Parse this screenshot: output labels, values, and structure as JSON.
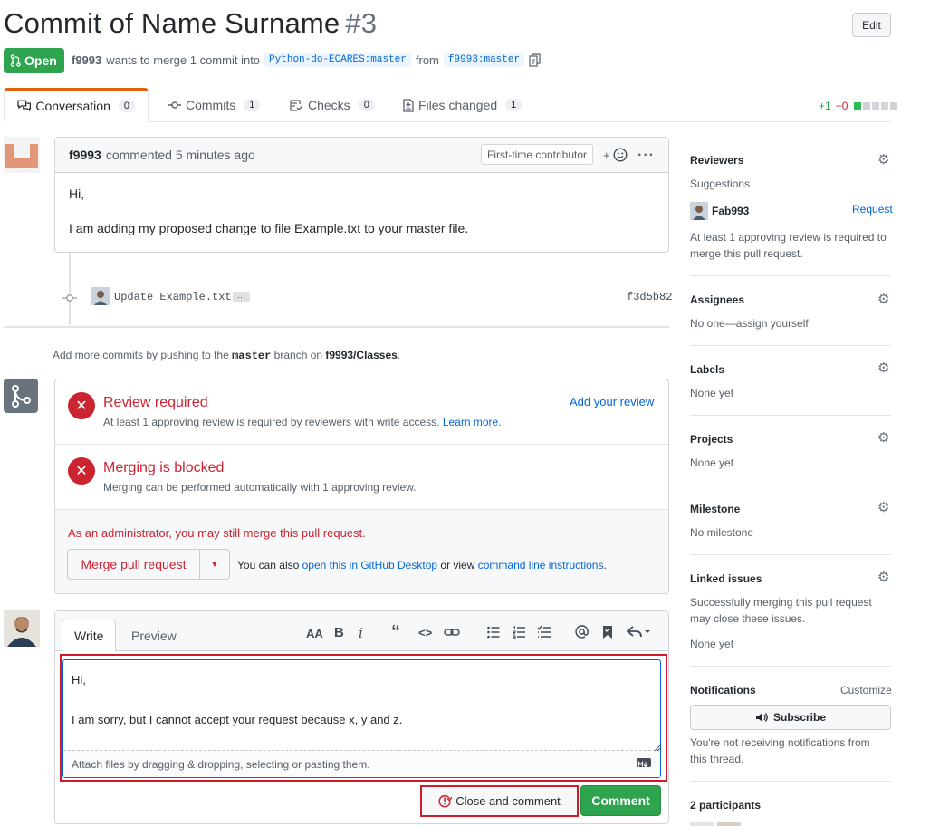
{
  "header": {
    "title": "Commit of Name Surname",
    "number": "#3",
    "edit_label": "Edit",
    "state": "Open",
    "author": "f9993",
    "merge_text": "wants to merge 1 commit into",
    "base_branch": "Python-do-ECARES:master",
    "from_text": "from",
    "head_branch": "f9993:master"
  },
  "tabs": [
    {
      "label": "Conversation",
      "count": "0"
    },
    {
      "label": "Commits",
      "count": "1"
    },
    {
      "label": "Checks",
      "count": "0"
    },
    {
      "label": "Files changed",
      "count": "1"
    }
  ],
  "diffstat": {
    "add": "+1",
    "del": "−0"
  },
  "comment": {
    "author": "f9993",
    "action": "commented 5 minutes ago",
    "badge": "First-time contributor",
    "line1": "Hi,",
    "line2": "I am adding my proposed change to file Example.txt to your master file."
  },
  "commit": {
    "message": "Update Example.txt",
    "ellipsis": "…",
    "sha": "f3d5b82"
  },
  "push_hint": {
    "pre": "Add more commits by pushing to the",
    "branch": "master",
    "mid": "branch on",
    "repo": "f9993/Classes",
    "post": "."
  },
  "merge_status": {
    "review_title": "Review required",
    "review_sub": "At least 1 approving review is required by reviewers with write access.",
    "learn_more": "Learn more.",
    "add_review": "Add your review",
    "blocked_title": "Merging is blocked",
    "blocked_sub": "Merging can be performed automatically with 1 approving review.",
    "admin_text": "As an administrator, you may still merge this pull request.",
    "merge_button": "Merge pull request",
    "also_pre": "You can also",
    "desktop_link": "open this in GitHub Desktop",
    "also_mid": "or view",
    "cli_link": "command line instructions",
    "also_post": "."
  },
  "editor": {
    "write_tab": "Write",
    "preview_tab": "Preview",
    "line1": "Hi,",
    "line3": "I am sorry, but I cannot accept your request because x, y and z.",
    "attach_hint": "Attach files by dragging & dropping, selecting or pasting them.",
    "close_label": "Close and comment",
    "comment_label": "Comment"
  },
  "sidebar": {
    "reviewers": {
      "title": "Reviewers",
      "suggestions": "Suggestions",
      "user": "Fab993",
      "request": "Request",
      "note": "At least 1 approving review is required to merge this pull request."
    },
    "assignees": {
      "title": "Assignees",
      "value": "No one—assign yourself"
    },
    "labels": {
      "title": "Labels",
      "value": "None yet"
    },
    "projects": {
      "title": "Projects",
      "value": "None yet"
    },
    "milestone": {
      "title": "Milestone",
      "value": "No milestone"
    },
    "linked": {
      "title": "Linked issues",
      "note": "Successfully merging this pull request may close these issues.",
      "value": "None yet"
    },
    "notifications": {
      "title": "Notifications",
      "customize": "Customize",
      "subscribe": "Subscribe",
      "note": "You're not receiving notifications from this thread."
    },
    "participants": "2 participants"
  },
  "colors": {
    "accent": "#e36209",
    "green": "#2ea44f",
    "red": "#cb2431",
    "link": "#0366d6"
  }
}
